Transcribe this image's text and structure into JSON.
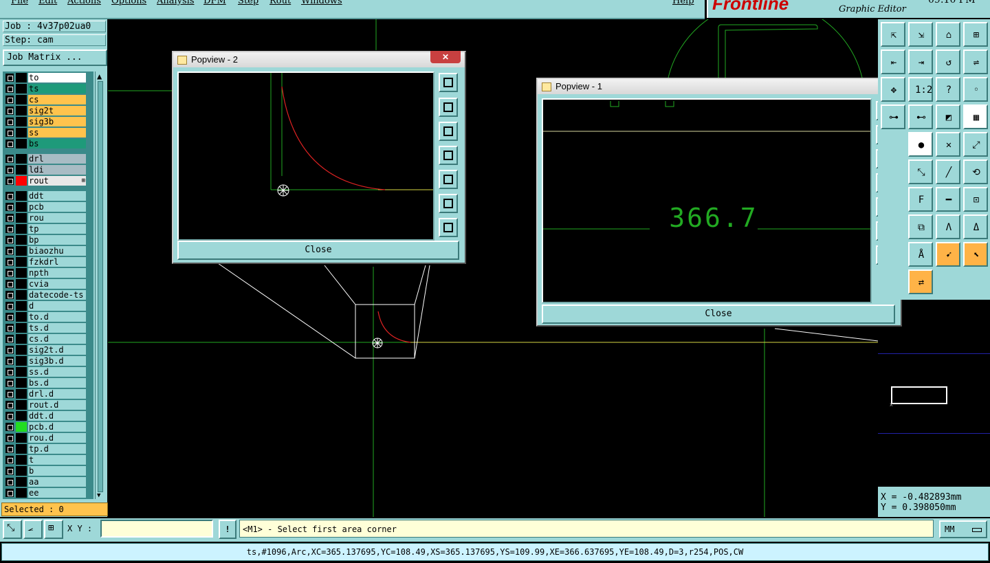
{
  "menubar": {
    "items": [
      "File",
      "Edit",
      "Actions",
      "Options",
      "Analysis",
      "DFM",
      "Step",
      "Rout",
      "Windows"
    ],
    "help": "Help"
  },
  "brand": {
    "logo": "Frontline",
    "subtitle": "Graphic Editor",
    "clock": "09:10 PM"
  },
  "job": {
    "job_label": "Job : 4v37p02ua0",
    "step_label": "Step: cam",
    "matrix_button": "Job Matrix ..."
  },
  "layers": [
    {
      "name": "to",
      "bg": "#ffffff",
      "swatch": "#000000"
    },
    {
      "name": "ts",
      "bg": "#1e9a7a",
      "swatch": "#000000"
    },
    {
      "name": "cs",
      "bg": "#ffc34d",
      "swatch": "#000000"
    },
    {
      "name": "sig2t",
      "bg": "#ffc34d",
      "swatch": "#000000"
    },
    {
      "name": "sig3b",
      "bg": "#ffc34d",
      "swatch": "#000000"
    },
    {
      "name": "ss",
      "bg": "#ffc34d",
      "swatch": "#000000"
    },
    {
      "name": "bs",
      "bg": "#1e9a7a",
      "swatch": "#000000"
    },
    {
      "name": "drl",
      "bg": "#a8bcc4",
      "swatch": "#000000"
    },
    {
      "name": "ldi",
      "bg": "#a8bcc4",
      "swatch": "#000000"
    },
    {
      "name": "rout",
      "bg": "#e8e8e8",
      "swatch": "#ff0000",
      "marker": "⊞"
    },
    {
      "name": "ddt",
      "bg": "#9ed8d8",
      "swatch": "#000000"
    },
    {
      "name": "pcb",
      "bg": "#9ed8d8",
      "swatch": "#000000"
    },
    {
      "name": "rou",
      "bg": "#9ed8d8",
      "swatch": "#000000"
    },
    {
      "name": "tp",
      "bg": "#9ed8d8",
      "swatch": "#000000"
    },
    {
      "name": "bp",
      "bg": "#9ed8d8",
      "swatch": "#000000"
    },
    {
      "name": "biaozhu",
      "bg": "#9ed8d8",
      "swatch": "#000000"
    },
    {
      "name": "fzkdrl",
      "bg": "#9ed8d8",
      "swatch": "#000000"
    },
    {
      "name": "npth",
      "bg": "#9ed8d8",
      "swatch": "#000000"
    },
    {
      "name": "cvia",
      "bg": "#9ed8d8",
      "swatch": "#000000"
    },
    {
      "name": "datecode-ts",
      "bg": "#9ed8d8",
      "swatch": "#000000"
    },
    {
      "name": "d",
      "bg": "#9ed8d8",
      "swatch": "#000000"
    },
    {
      "name": "to.d",
      "bg": "#9ed8d8",
      "swatch": "#000000"
    },
    {
      "name": "ts.d",
      "bg": "#9ed8d8",
      "swatch": "#000000"
    },
    {
      "name": "cs.d",
      "bg": "#9ed8d8",
      "swatch": "#000000"
    },
    {
      "name": "sig2t.d",
      "bg": "#9ed8d8",
      "swatch": "#000000"
    },
    {
      "name": "sig3b.d",
      "bg": "#9ed8d8",
      "swatch": "#000000"
    },
    {
      "name": "ss.d",
      "bg": "#9ed8d8",
      "swatch": "#000000"
    },
    {
      "name": "bs.d",
      "bg": "#9ed8d8",
      "swatch": "#000000"
    },
    {
      "name": "drl.d",
      "bg": "#9ed8d8",
      "swatch": "#000000"
    },
    {
      "name": "rout.d",
      "bg": "#9ed8d8",
      "swatch": "#000000"
    },
    {
      "name": "ddt.d",
      "bg": "#9ed8d8",
      "swatch": "#000000"
    },
    {
      "name": "pcb.d",
      "bg": "#9ed8d8",
      "swatch": "#22dd22"
    },
    {
      "name": "rou.d",
      "bg": "#9ed8d8",
      "swatch": "#000000"
    },
    {
      "name": "tp.d",
      "bg": "#9ed8d8",
      "swatch": "#000000"
    },
    {
      "name": "t",
      "bg": "#9ed8d8",
      "swatch": "#000000"
    },
    {
      "name": "b",
      "bg": "#9ed8d8",
      "swatch": "#000000"
    },
    {
      "name": "aa",
      "bg": "#9ed8d8",
      "swatch": "#000000"
    },
    {
      "name": "ee",
      "bg": "#9ed8d8",
      "swatch": "#000000"
    }
  ],
  "selected_label": "Selected : 0",
  "popview2": {
    "title": "Popview - 2",
    "close_label": "Close",
    "close_x": "✕"
  },
  "popview1": {
    "title": "Popview - 1",
    "close_label": "Close",
    "close_x": "✕",
    "measure_text": "366.7"
  },
  "coords": {
    "x": "X = -0.482893mm",
    "y": "Y = 0.398050mm"
  },
  "bottom": {
    "xy_label": "X Y :",
    "xy_value": "",
    "bang": "!",
    "prompt": "<M1> - Select first area corner",
    "units": "MM"
  },
  "status_line": "ts,#1096,Arc,XC=365.137695,YC=108.49,XS=365.137695,YS=109.99,XE=366.637695,YE=108.49,D=3,r254,POS,CW",
  "tools": [
    {
      "g": "⇱",
      "v": "n"
    },
    {
      "g": "⇲",
      "v": "n"
    },
    {
      "g": "⌂",
      "v": "n"
    },
    {
      "g": "⊞",
      "v": "n"
    },
    {
      "g": "⇤",
      "v": "n"
    },
    {
      "g": "⇥",
      "v": "n"
    },
    {
      "g": "↺",
      "v": "n"
    },
    {
      "g": "⇌",
      "v": "n"
    },
    {
      "g": "✥",
      "v": "n"
    },
    {
      "g": "1:2",
      "v": "n"
    },
    {
      "g": "?",
      "v": "n"
    },
    {
      "g": "◦",
      "v": "n"
    },
    {
      "g": "⊶",
      "v": "n"
    },
    {
      "g": "⊷",
      "v": "n"
    },
    {
      "g": "◩",
      "v": "n"
    },
    {
      "g": "▦",
      "v": "w"
    },
    {
      "g": "●",
      "v": "w"
    },
    {
      "g": "✕",
      "v": "n"
    },
    {
      "g": "⤢",
      "v": "n"
    },
    {
      "g": "⤡",
      "v": "n"
    },
    {
      "g": "╱",
      "v": "n"
    },
    {
      "g": "⟲",
      "v": "n"
    },
    {
      "g": "F",
      "v": "n"
    },
    {
      "g": "━",
      "v": "n"
    },
    {
      "g": "⊡",
      "v": "n"
    },
    {
      "g": "⧉",
      "v": "n"
    },
    {
      "g": "Λ",
      "v": "n"
    },
    {
      "g": "Δ",
      "v": "n"
    },
    {
      "g": "Å",
      "v": "n"
    },
    {
      "g": "➹",
      "v": "o"
    },
    {
      "g": "⬉",
      "v": "o"
    },
    {
      "g": "⇄",
      "v": "o"
    }
  ]
}
